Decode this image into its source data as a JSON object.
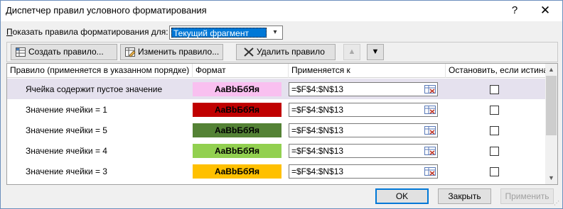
{
  "window": {
    "title": "Диспетчер правил условного форматирования",
    "help_label": "?",
    "close_label": "✕"
  },
  "show_rules": {
    "label_prefix": "",
    "label_mnemonic": "П",
    "label_rest": "оказать правила форматирования для:",
    "selected": "Текущий фрагмент",
    "arrow": "▾"
  },
  "toolbar": {
    "new_rule": "Создать правило...",
    "edit_rule": "Изменить правило...",
    "delete_rule": "Удалить правило",
    "move_up": "▲",
    "move_down": "▼"
  },
  "columns": {
    "rule": "Правило (применяется в указанном порядке)",
    "format": "Формат",
    "applies_to": "Применяется к",
    "stop_if_true": "Остановить, если истина"
  },
  "rules": [
    {
      "name": "Ячейка содержит пустое значение",
      "preview": "AaBbБбЯя",
      "applies": "=$F$4:$N$13",
      "stop": false,
      "bg": "#f9c0f0",
      "fg": "#000000",
      "selected": true
    },
    {
      "name": "Значение ячейки = 1",
      "preview": "AaBbБбЯя",
      "applies": "=$F$4:$N$13",
      "stop": false,
      "bg": "#c00000",
      "fg": "#000000",
      "selected": false
    },
    {
      "name": "Значение ячейки = 5",
      "preview": "AaBbБбЯя",
      "applies": "=$F$4:$N$13",
      "stop": false,
      "bg": "#548235",
      "fg": "#000000",
      "selected": false
    },
    {
      "name": "Значение ячейки = 4",
      "preview": "AaBbБбЯя",
      "applies": "=$F$4:$N$13",
      "stop": false,
      "bg": "#92d050",
      "fg": "#000000",
      "selected": false
    },
    {
      "name": "Значение ячейки = 3",
      "preview": "AaBbБбЯя",
      "applies": "=$F$4:$N$13",
      "stop": false,
      "bg": "#ffc000",
      "fg": "#000000",
      "selected": false
    }
  ],
  "scrollbar": {
    "up": "▲",
    "down": "▼"
  },
  "buttons": {
    "ok": "OK",
    "close": "Закрыть",
    "apply": "Применить"
  },
  "colors": {
    "selection": "#0078d7",
    "selected_row": "#e5e1ee"
  }
}
